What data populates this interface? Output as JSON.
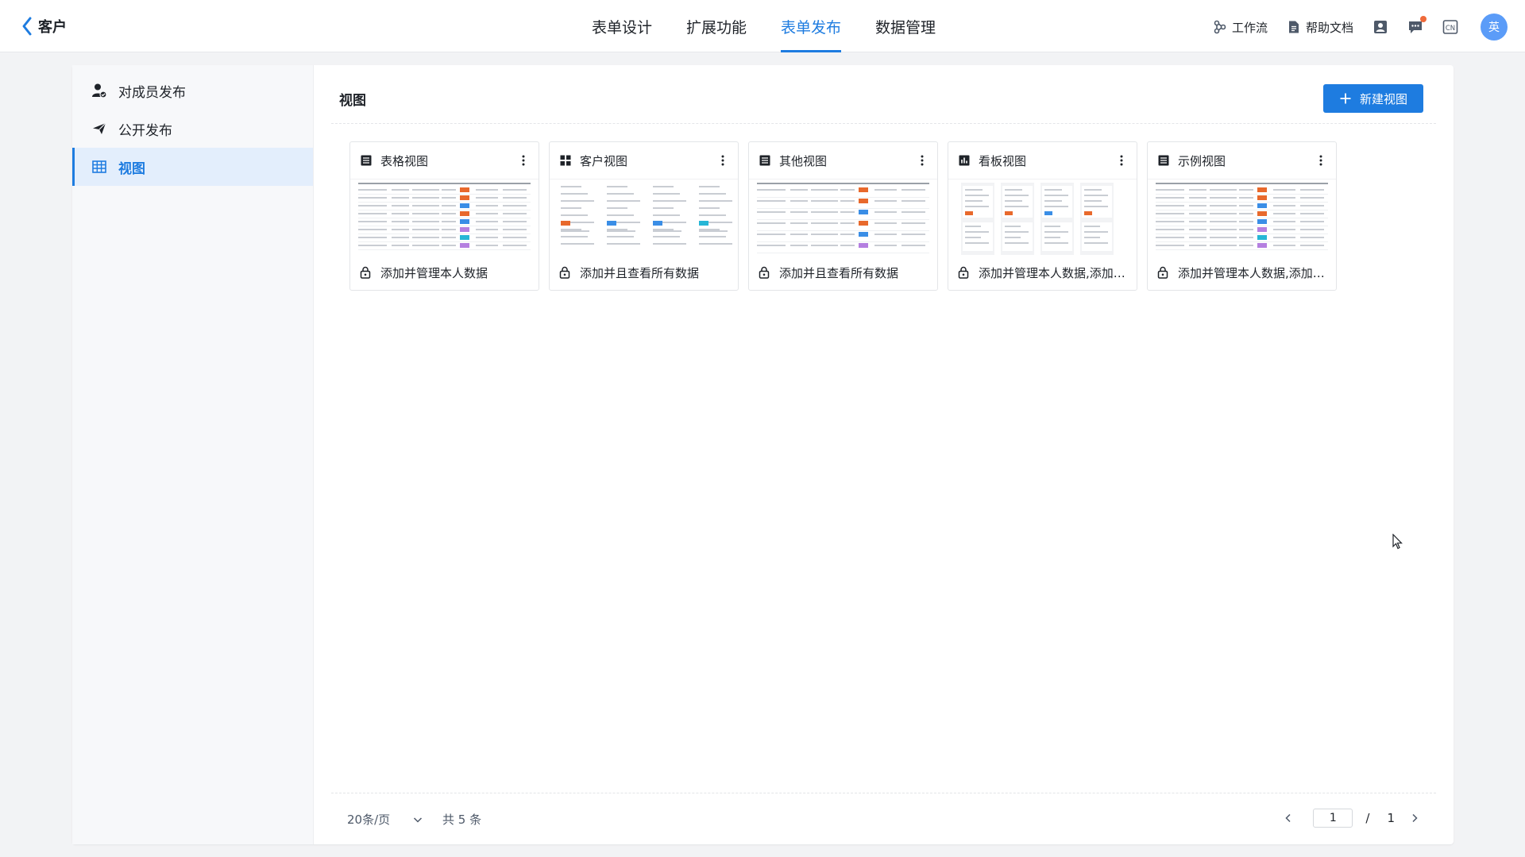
{
  "header": {
    "back_title": "客户",
    "tabs": [
      {
        "label": "表单设计",
        "active": false
      },
      {
        "label": "扩展功能",
        "active": false
      },
      {
        "label": "表单发布",
        "active": true
      },
      {
        "label": "数据管理",
        "active": false
      }
    ],
    "tools": {
      "workflow_label": "工作流",
      "help_label": "帮助文档",
      "lang_icon": "CN",
      "avatar_text": "英"
    }
  },
  "sidebar": {
    "items": [
      {
        "label": "对成员发布",
        "icon": "user-icon",
        "active": false
      },
      {
        "label": "公开发布",
        "icon": "send-icon",
        "active": false
      },
      {
        "label": "视图",
        "icon": "table-icon",
        "active": true
      }
    ]
  },
  "main": {
    "title": "视图",
    "new_button_label": "新建视图",
    "views": [
      {
        "name": "表格视图",
        "icon": "list-icon",
        "permission": "添加并管理本人数据",
        "thumb": "table"
      },
      {
        "name": "客户视图",
        "icon": "grid-icon",
        "permission": "添加并且查看所有数据",
        "thumb": "cards"
      },
      {
        "name": "其他视图",
        "icon": "list-icon",
        "permission": "添加并且查看所有数据",
        "thumb": "table-sparse"
      },
      {
        "name": "看板视图",
        "icon": "kanban-icon",
        "permission": "添加并管理本人数据,添加并且查看所有数据",
        "thumb": "kanban"
      },
      {
        "name": "示例视图",
        "icon": "list-icon",
        "permission": "添加并管理本人数据,添加并且查看所有数据",
        "thumb": "table"
      }
    ]
  },
  "pagination": {
    "page_size_label": "20条/页",
    "total_label": "共 5 条",
    "current_page": "1",
    "separator": "/",
    "total_pages": "1"
  },
  "colors": {
    "accent": "#1e7ce0",
    "tag_orange": "#e8692c",
    "tag_blue": "#3a8ee6",
    "tag_purple": "#b47fe0",
    "tag_cyan": "#26b6d6"
  }
}
